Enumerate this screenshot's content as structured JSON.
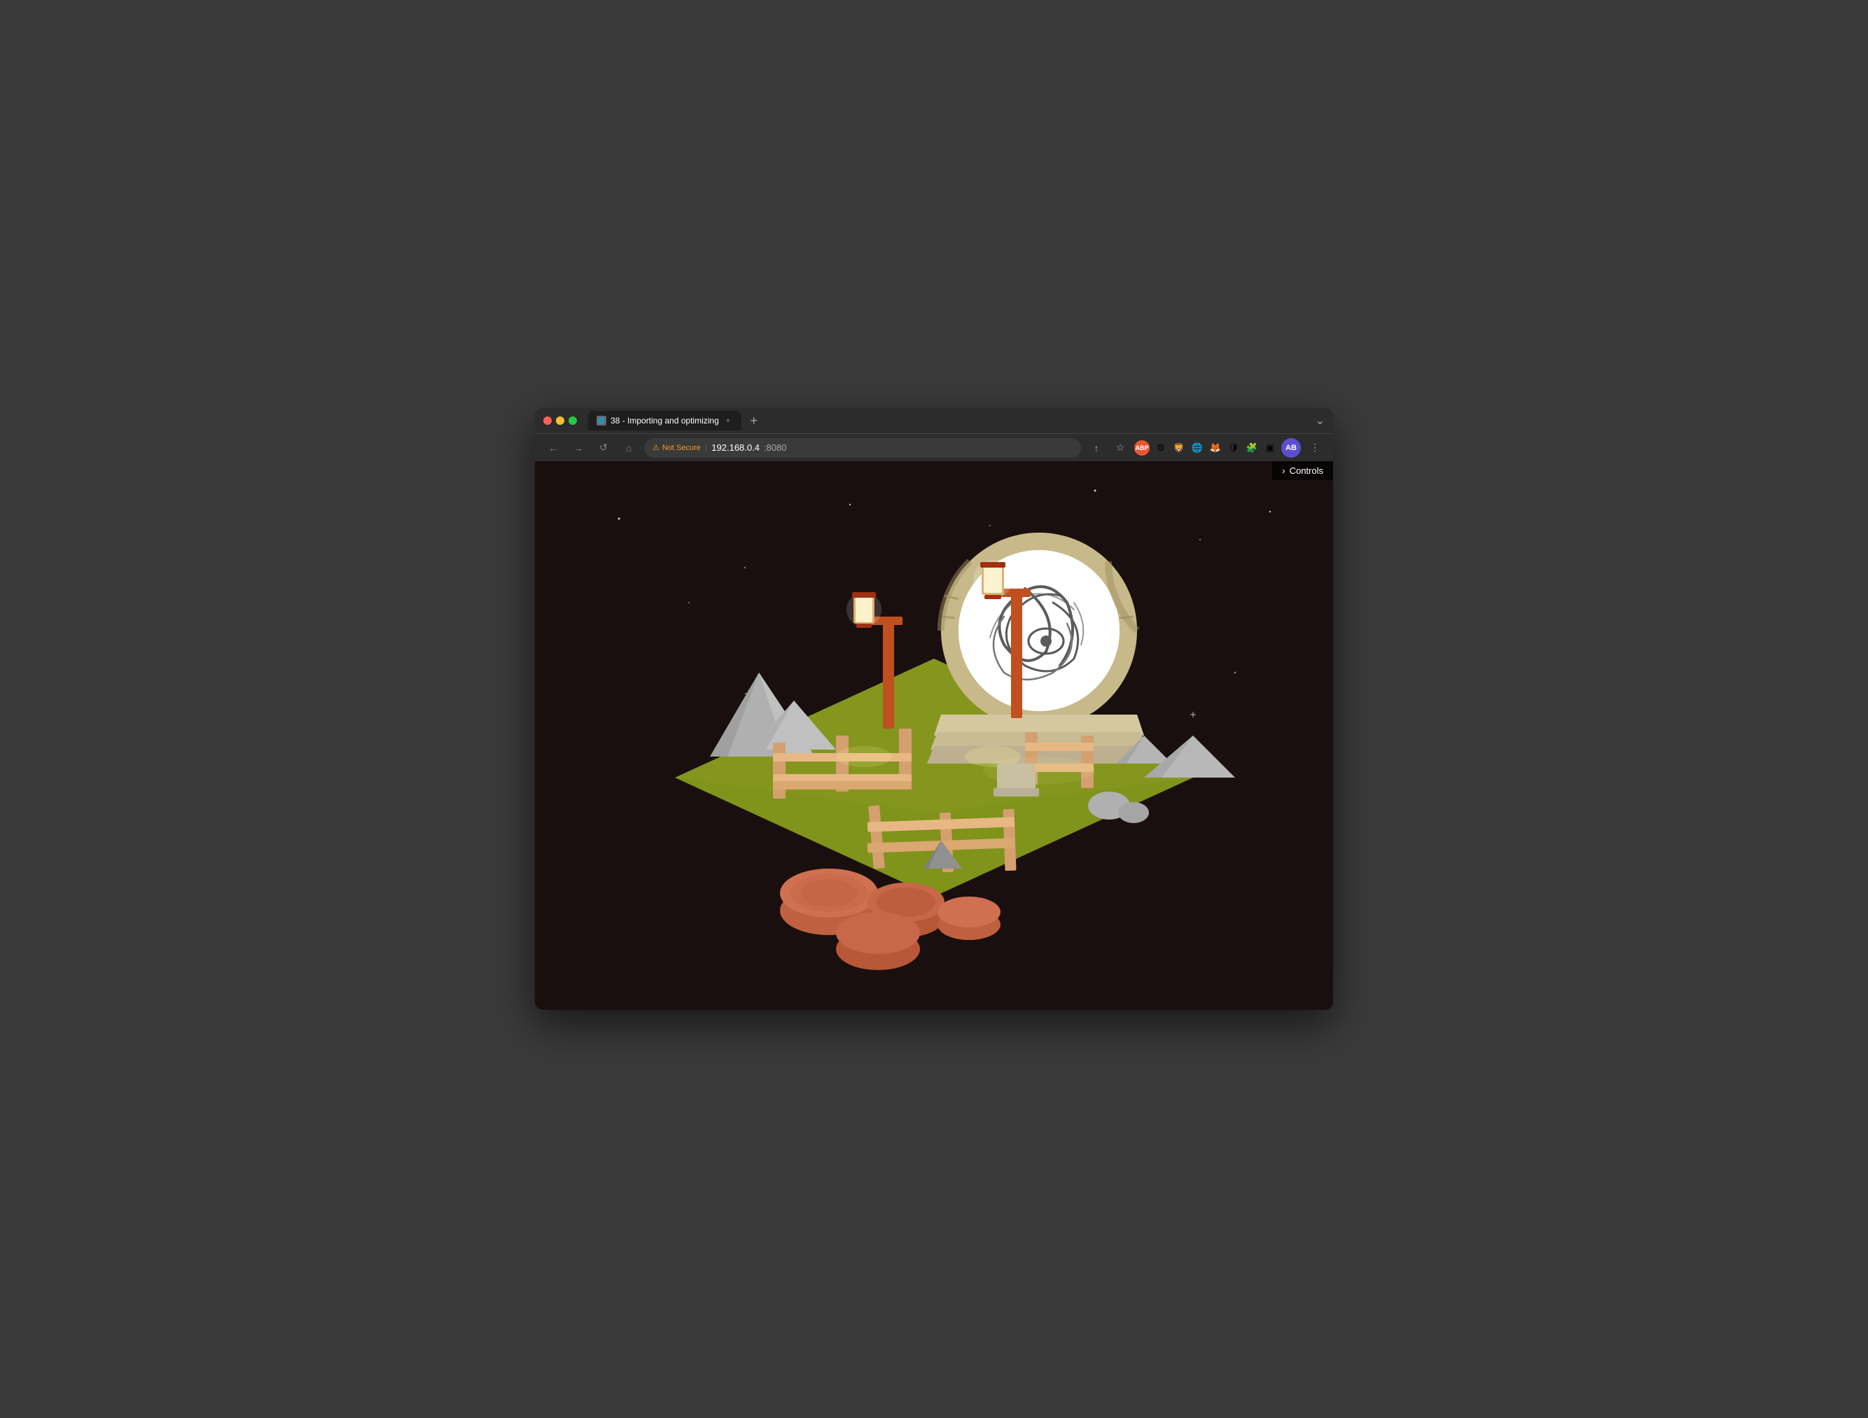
{
  "browser": {
    "tab": {
      "favicon": "🌐",
      "title": "38 - Importing and optimizing",
      "close_icon": "×"
    },
    "new_tab_icon": "+",
    "window_controls": "⌄",
    "nav": {
      "back_label": "←",
      "forward_label": "→",
      "reload_label": "↺",
      "home_label": "⌂",
      "security_warning": "⚠",
      "security_text": "Not Secure",
      "address_separator": "|",
      "address_host": "192.168.0.4",
      "address_port": ":8080",
      "share_icon": "↑",
      "bookmark_icon": "☆",
      "profile_initials": "AB"
    },
    "extensions": {
      "abp_label": "ABP",
      "gear_icon": "⚙",
      "brave_icon": "🦁",
      "globe_icon": "🌐",
      "fox_icon": "🦊",
      "shield_icon": "🛡",
      "puzzle_icon": "🧩",
      "sidebar_icon": "▣",
      "menu_icon": "⋮"
    }
  },
  "controls_panel": {
    "arrow": "›",
    "label": "Controls"
  },
  "scene": {
    "background_color": "#1a0f0f",
    "description": "Low-poly 3D scene with portal, rocks, lanterns, fence, and tree stumps"
  }
}
